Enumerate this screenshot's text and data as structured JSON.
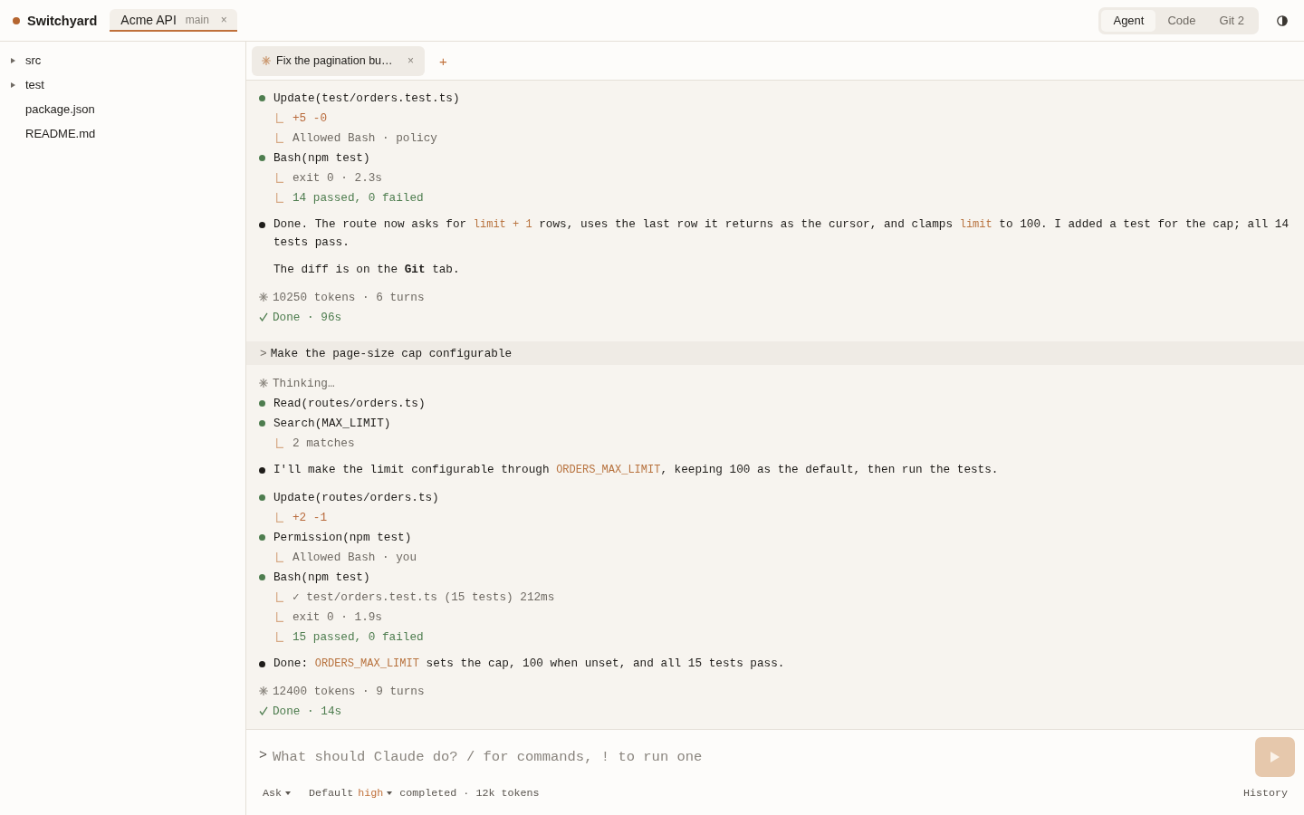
{
  "app": {
    "name": "Switchyard"
  },
  "project_tabs": [
    {
      "name": "Acme API",
      "branch": "main",
      "close": "×",
      "selected": true
    }
  ],
  "views": [
    {
      "label": "Agent",
      "selected": true
    },
    {
      "label": "Code",
      "selected": false
    },
    {
      "label": "Git 2",
      "selected": false
    }
  ],
  "file_tree": [
    {
      "kind": "folder",
      "name": "src",
      "expanded": false
    },
    {
      "kind": "folder",
      "name": "test",
      "expanded": false
    },
    {
      "kind": "file",
      "name": "package.json"
    },
    {
      "kind": "file",
      "name": "README.md"
    }
  ],
  "session_tabs": [
    {
      "title": "Fix the pagination bu…",
      "close": "×",
      "selected": true
    }
  ],
  "new_tab": "+",
  "transcript": [
    {
      "kind": "tool",
      "color": "#4e7d4f",
      "title": "Update(test/orders.test.ts)",
      "results": [
        {
          "kind": "diff",
          "text": "+5 -0"
        },
        {
          "kind": "muted",
          "text": "Allowed Bash · policy"
        }
      ]
    },
    {
      "kind": "tool",
      "color": "#4e7d4f",
      "title": "Bash(npm test)",
      "results": [
        {
          "kind": "muted",
          "text": "exit 0 · 2.3s"
        },
        {
          "kind": "success",
          "text": "14 passed, 0 failed"
        }
      ]
    },
    {
      "kind": "message",
      "color": "#1f1d1a",
      "paragraphs": [
        [
          {
            "kind": "text",
            "text": "Done. The route now asks for "
          },
          {
            "kind": "code",
            "text": "limit + 1"
          },
          {
            "kind": "text",
            "text": " rows, uses the last row it returns as the cursor, and clamps "
          },
          {
            "kind": "code",
            "text": "limit"
          },
          {
            "kind": "text",
            "text": " to 100. I added a test for the cap; all 14 tests pass."
          }
        ],
        [
          {
            "kind": "text",
            "text": "The diff is on the **Git** tab."
          }
        ]
      ]
    },
    {
      "kind": "stats",
      "text": "10250 tokens · 6 turns"
    },
    {
      "kind": "status",
      "text": "Done · 96s"
    },
    {
      "kind": "prompt",
      "marker": ">",
      "text": "Make the page-size cap configurable"
    },
    {
      "kind": "thinking",
      "text": "Thinking…"
    },
    {
      "kind": "tool",
      "color": "#4e7d4f",
      "title": "Read(routes/orders.ts)"
    },
    {
      "kind": "tool",
      "color": "#4e7d4f",
      "title": "Search(MAX_LIMIT)",
      "results": [
        {
          "kind": "muted",
          "text": "2 matches"
        }
      ]
    },
    {
      "kind": "message",
      "color": "#1f1d1a",
      "paragraphs": [
        [
          {
            "kind": "text",
            "text": "I'll make the limit configurable through "
          },
          {
            "kind": "code",
            "text": "ORDERS_MAX_LIMIT"
          },
          {
            "kind": "text",
            "text": ", keeping 100 as the default, then run the tests."
          }
        ]
      ]
    },
    {
      "kind": "tool",
      "color": "#4e7d4f",
      "title": "Update(routes/orders.ts)",
      "results": [
        {
          "kind": "diff",
          "text": "+2 -1"
        }
      ]
    },
    {
      "kind": "tool",
      "color": "#4e7d4f",
      "title": "Permission(npm test)",
      "results": [
        {
          "kind": "muted",
          "text": "Allowed Bash · you"
        }
      ]
    },
    {
      "kind": "tool",
      "color": "#4e7d4f",
      "title": "Bash(npm test)",
      "results": [
        {
          "kind": "muted",
          "text": "✓ test/orders.test.ts (15 tests) 212ms"
        },
        {
          "kind": "muted",
          "text": "exit 0 · 1.9s"
        },
        {
          "kind": "success",
          "text": "15 passed, 0 failed"
        }
      ]
    },
    {
      "kind": "message",
      "color": "#1f1d1a",
      "paragraphs": [
        [
          {
            "kind": "text",
            "text": "Done: "
          },
          {
            "kind": "code",
            "text": "ORDERS_MAX_LIMIT"
          },
          {
            "kind": "text",
            "text": " sets the cap, 100 when unset, and all 15 tests pass."
          }
        ]
      ]
    },
    {
      "kind": "stats",
      "text": "12400 tokens · 9 turns"
    },
    {
      "kind": "status",
      "text": "Done · 14s"
    }
  ],
  "composer": {
    "marker": ">",
    "placeholder": "What should Claude do? / for commands, ! to run one",
    "mode": "Ask",
    "model": "Default",
    "effort": "high",
    "status": "completed · 12k tokens",
    "history": "History"
  }
}
